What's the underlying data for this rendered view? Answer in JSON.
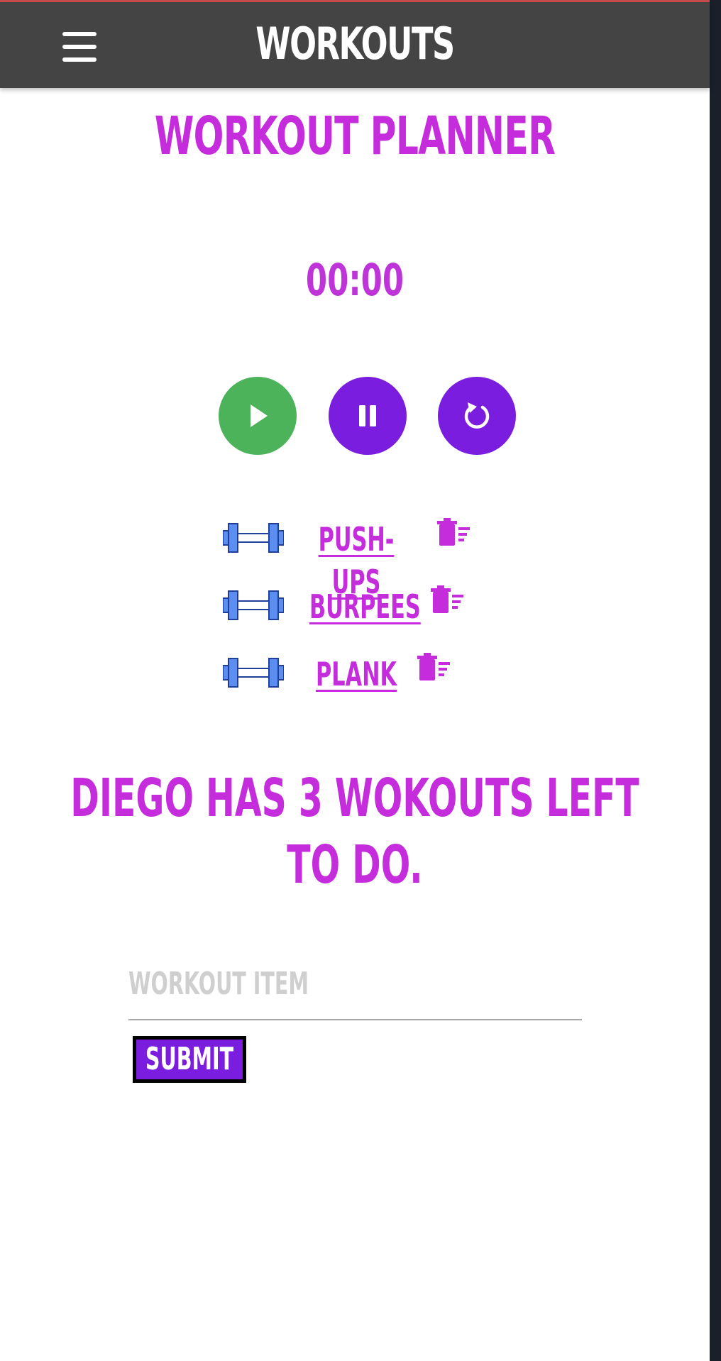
{
  "header": {
    "title": "WORKOUTS",
    "menu_icon": "hamburger-menu-icon"
  },
  "main": {
    "title": "WORKOUT PLANNER",
    "timer": "00:00",
    "controls": [
      {
        "icon": "play-icon",
        "color": "#4cb35a"
      },
      {
        "icon": "pause-icon",
        "color": "#7a1ddf"
      },
      {
        "icon": "reset-icon",
        "color": "#7a1ddf"
      }
    ],
    "workouts": [
      {
        "name": "PUSH-UPS",
        "icon": "dumbbell-icon",
        "delete_icon": "trash-icon"
      },
      {
        "name": "BURPEES",
        "icon": "dumbbell-icon",
        "delete_icon": "trash-icon"
      },
      {
        "name": "PLANK",
        "icon": "dumbbell-icon",
        "delete_icon": "trash-icon"
      }
    ],
    "summary": "DIEGO HAS 3 WOKOUTS LEFT TO DO."
  },
  "form": {
    "input_value": "",
    "input_placeholder": "WORKOUT ITEM",
    "submit_label": "SUBMIT"
  },
  "colors": {
    "header_bg": "#444444",
    "accent_magenta": "#c42cdc",
    "accent_purple": "#7a1ddf",
    "play_green": "#4cb35a",
    "dumbbell_blue": "#5b8ef0"
  }
}
